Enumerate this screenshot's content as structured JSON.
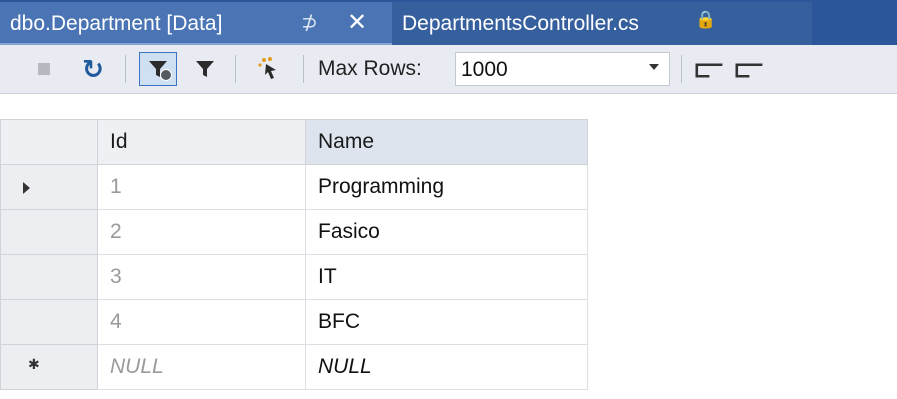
{
  "tabs": {
    "active": {
      "title": "dbo.Department [Data]",
      "pin_glyph": "⊅",
      "close_glyph": "✕"
    },
    "inactive": {
      "title": "DepartmentsController.cs",
      "lock_glyph": "🔒"
    }
  },
  "toolbar": {
    "icons": [
      "stop-icon",
      "refresh-icon",
      "apply-filter-icon",
      "filter-icon",
      "execute-icon",
      "script-icon",
      "script-file-icon"
    ],
    "refresh_glyph": "↻",
    "max_rows_label": "Max Rows:",
    "max_rows_value": "1000",
    "script_glyph": "⫍",
    "script_file_glyph": "⫍"
  },
  "grid": {
    "columns": [
      "Id",
      "Name"
    ],
    "rows": [
      {
        "id": "1",
        "name": "Programming",
        "selected": true
      },
      {
        "id": "2",
        "name": "Fasico"
      },
      {
        "id": "3",
        "name": "IT"
      },
      {
        "id": "4",
        "name": "BFC"
      }
    ],
    "new_row": {
      "id": "NULL",
      "name": "NULL",
      "marker": "✱"
    }
  },
  "colors": {
    "tab_strip": "#2b579a",
    "active_tab": "#4a74b3",
    "toolbar": "#e8ecf2",
    "refresh_blue": "#1e5a9c"
  }
}
